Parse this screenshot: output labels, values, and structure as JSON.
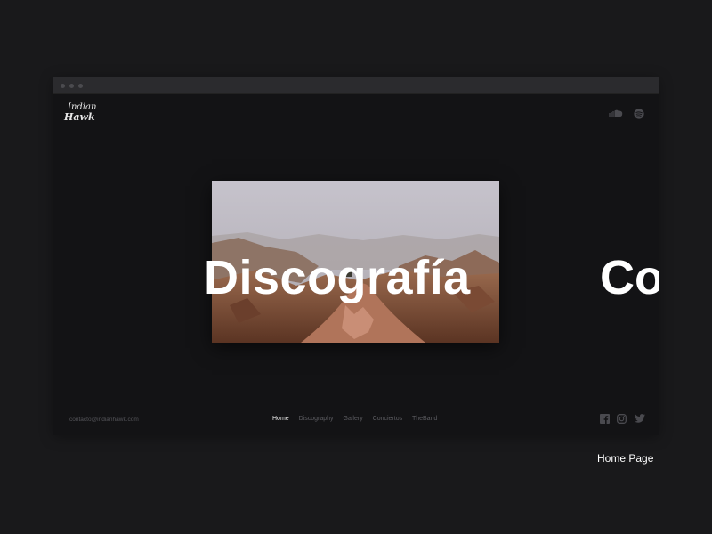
{
  "logo": {
    "line1": "Indian",
    "line2": "Hawk"
  },
  "slides": {
    "current": "Discografía",
    "next": "Co"
  },
  "footer": {
    "contact": "contacto@indianhawk.com",
    "nav": [
      "Home",
      "Discography",
      "Gallery",
      "Conciertos",
      "TheBand"
    ],
    "active_nav": "Home"
  },
  "icons": {
    "top": [
      "soundcloud-icon",
      "spotify-icon"
    ],
    "social": [
      "facebook-icon",
      "instagram-icon",
      "twitter-icon"
    ]
  },
  "caption": "Home Page",
  "colors": {
    "page_bg": "#19191b",
    "site_bg": "#131315",
    "chrome": "#2b2b2e",
    "text": "#ffffff"
  }
}
